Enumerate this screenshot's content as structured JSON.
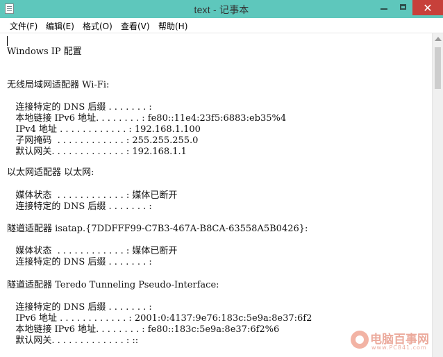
{
  "window": {
    "title": "text - 记事本",
    "close_glyph": "✕"
  },
  "menu": {
    "file": "文件(F)",
    "edit": "编辑(E)",
    "format": "格式(O)",
    "view": "查看(V)",
    "help": "帮助(H)"
  },
  "content": {
    "lines": [
      "Windows IP 配置",
      "",
      "",
      "无线局域网适配器 Wi-Fi:",
      "",
      "   连接特定的 DNS 后缀 . . . . . . . :",
      "   本地链接 IPv6 地址. . . . . . . . : fe80::11e4:23f5:6883:eb35%4",
      "   IPv4 地址 . . . . . . . . . . . . : 192.168.1.100",
      "   子网掩码  . . . . . . . . . . . . : 255.255.255.0",
      "   默认网关. . . . . . . . . . . . . : 192.168.1.1",
      "",
      "以太网适配器 以太网:",
      "",
      "   媒体状态  . . . . . . . . . . . . : 媒体已断开",
      "   连接特定的 DNS 后缀 . . . . . . . :",
      "",
      "隧道适配器 isatap.{7DDFFF99-C7B3-467A-B8CA-63558A5B0426}:",
      "",
      "   媒体状态  . . . . . . . . . . . . : 媒体已断开",
      "   连接特定的 DNS 后缀 . . . . . . . :",
      "",
      "隧道适配器 Teredo Tunneling Pseudo-Interface:",
      "",
      "   连接特定的 DNS 后缀 . . . . . . . :",
      "   IPv6 地址 . . . . . . . . . . . . : 2001:0:4137:9e76:183c:5e9a:8e37:6f2",
      "   本地链接 IPv6 地址. . . . . . . . : fe80::183c:5e9a:8e37:6f2%6",
      "   默认网关. . . . . . . . . . . . . : ::"
    ]
  },
  "watermark": {
    "brand": "电脑百事网",
    "url": "www.PC841.com"
  }
}
